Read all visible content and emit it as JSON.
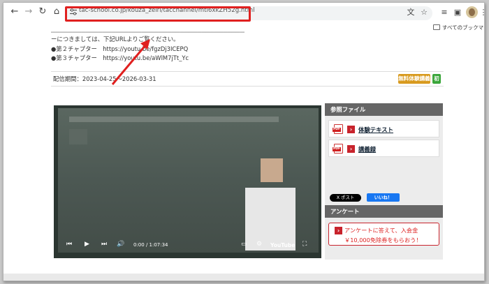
{
  "browser": {
    "url": "tac-school.co.jp/kouza_zeiri/tacchannel/mti6xkZH52g.html",
    "bookmarks_label": "すべてのブックマーク"
  },
  "content": {
    "faded_line": "ーにつきましては、下記URLよりご覧ください。",
    "intro_line": "ーにつきましては、下記URLよりご覧ください。",
    "chapter2": "●第２チャプター　https://youtu.be/fgzDj3ICEPQ",
    "chapter3": "●第３チャプター　https://youtu.be/aWlM7jTt_Yc",
    "date": "配信期間：2023-04-25～2026-03-31",
    "badge_trial": "無料体験講義",
    "badge_first": "初"
  },
  "video": {
    "time": "0:00 / 1:07:34",
    "brand": "YouTube"
  },
  "sidebar": {
    "files_header": "参照ファイル",
    "files": [
      {
        "label": "体験テキスト"
      },
      {
        "label": "講義録"
      }
    ],
    "x_post": "X ポスト",
    "fb_like": "いいね！",
    "survey_header": "アンケート",
    "survey_line1": "アンケートに答えて、入会金",
    "survey_line2": "￥10,000免除券をもらおう！"
  },
  "colors": {
    "highlight": "#e0201f",
    "badge_trial": "#d89a1e",
    "badge_first": "#3aa63a",
    "accent_red": "#c8232c"
  }
}
